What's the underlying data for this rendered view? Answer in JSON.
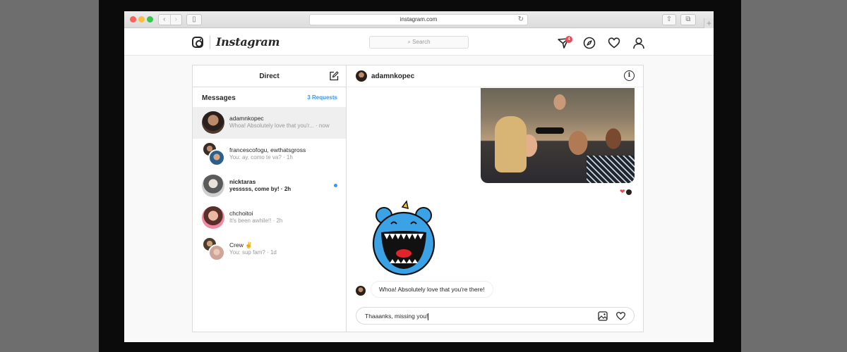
{
  "browser": {
    "url": "instagram.com",
    "plus": "+"
  },
  "header": {
    "wordmark": "Instagram",
    "search_placeholder": "Search",
    "activity_badge": "4"
  },
  "direct": {
    "title": "Direct",
    "messages_label": "Messages",
    "requests_label": "3 Requests"
  },
  "conversations": [
    {
      "name": "adamnkopec",
      "preview": "Whoa! Absolutely love that you'r... · now"
    },
    {
      "name": "francescofogu, ewthatsgross",
      "preview": "You: ay, como te va? · 1h"
    },
    {
      "name": "nicktaras",
      "preview": "yesssss, come by! · 2h"
    },
    {
      "name": "chchoitoi",
      "preview": "It's been awhile!! · 2h"
    },
    {
      "name": "Crew ✌️",
      "preview": "You: sup fam? · 1d"
    }
  ],
  "thread": {
    "name": "adamnkopec",
    "info_icon": "i",
    "incoming_message": "Whoa! Absolutely love that you're there!",
    "composer_text": "Thaaanks, missing you!",
    "reaction_heart": "❤"
  },
  "colors": {
    "accent": "#3897f0",
    "badge": "#ed4956",
    "sticker": "#3ba2e6"
  },
  "icons": [
    "camera-icon",
    "search-icon",
    "direct-icon",
    "compass-icon",
    "heart-icon",
    "profile-icon",
    "compose-icon",
    "info-icon",
    "image-icon",
    "heart-icon"
  ]
}
